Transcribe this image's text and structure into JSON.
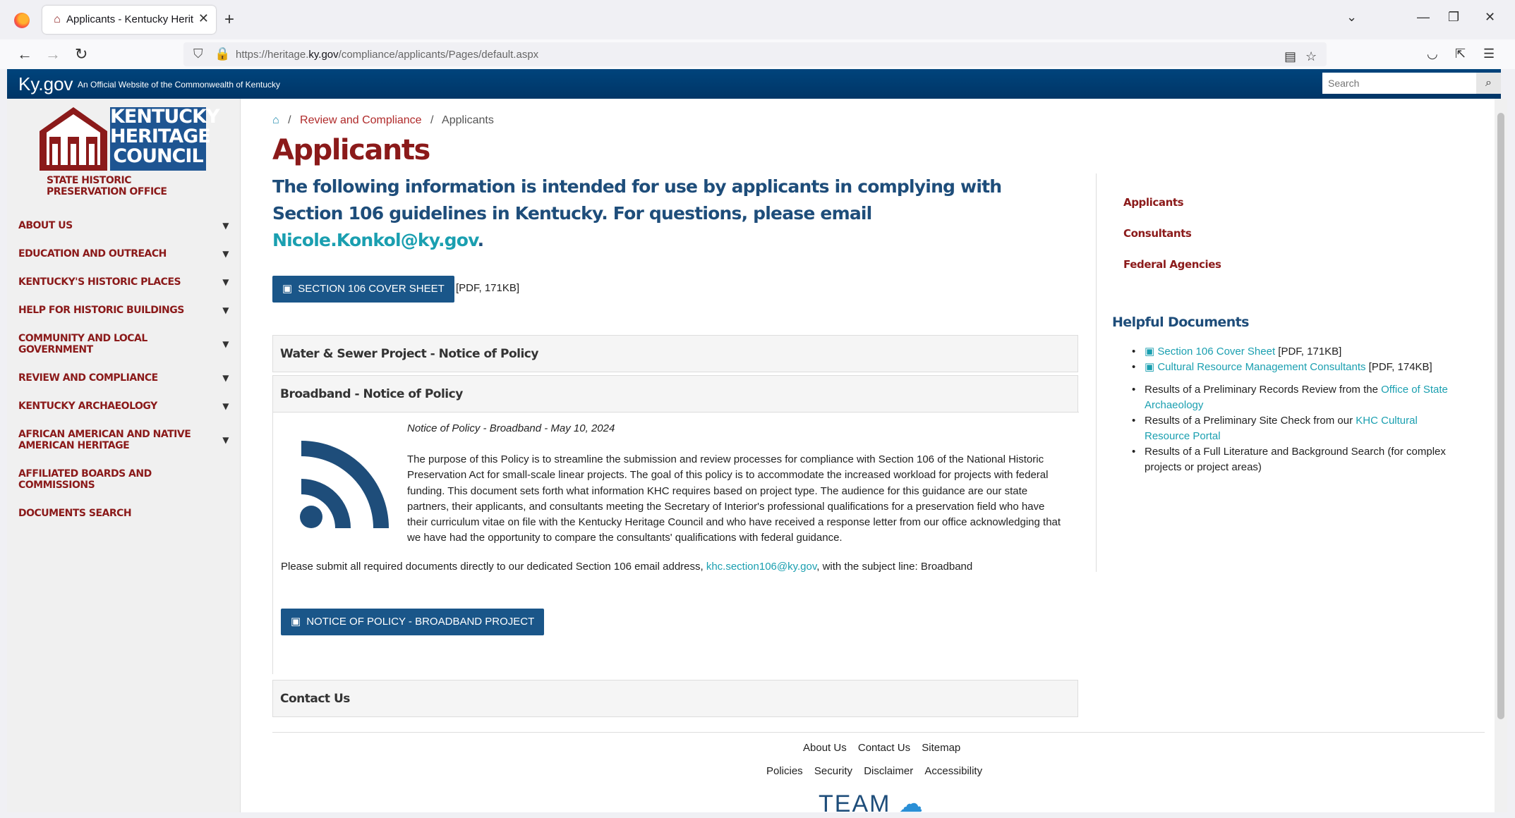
{
  "browser": {
    "tab_title": "Applicants - Kentucky Heritage Council",
    "url_prefix": "https://heritage.",
    "url_domain": "ky.gov",
    "url_path": "/compliance/applicants/Pages/default.aspx"
  },
  "kygov": {
    "logo": "Ky.gov",
    "tagline": "An Official Website of the Commonwealth of Kentucky",
    "search_placeholder": "Search"
  },
  "logo": {
    "line1": "KENTUCKY",
    "line2": "HERITAGE",
    "line3": "COUNCIL",
    "subtitle": "STATE HISTORIC PRESERVATION OFFICE"
  },
  "sidebar": {
    "items": [
      {
        "label": "ABOUT US",
        "caret": true
      },
      {
        "label": "EDUCATION AND OUTREACH",
        "caret": true
      },
      {
        "label": "KENTUCKY'S HISTORIC PLACES",
        "caret": true
      },
      {
        "label": "HELP FOR HISTORIC BUILDINGS",
        "caret": true
      },
      {
        "label": "COMMUNITY AND LOCAL GOVERNMENT",
        "caret": true
      },
      {
        "label": "REVIEW AND COMPLIANCE",
        "caret": true
      },
      {
        "label": "KENTUCKY ARCHAEOLOGY",
        "caret": true
      },
      {
        "label": "AFRICAN AMERICAN AND NATIVE AMERICAN HERITAGE",
        "caret": true
      },
      {
        "label": "AFFILIATED BOARDS AND COMMISSIONS",
        "caret": false
      },
      {
        "label": "DOCUMENTS SEARCH",
        "caret": false
      }
    ]
  },
  "breadcrumb": {
    "sep": "/",
    "parent": "Review and Compliance",
    "current": "Applicants"
  },
  "main": {
    "title": "Applicants",
    "intro": "The following information is intended for use by applicants in complying with Section 106 guidelines in Kentucky. For questions, please email ",
    "intro_email": "Nicole.Konkol@ky.gov",
    "intro_end": ".",
    "cover_button": "SECTION 106 COVER SHEET",
    "cover_meta": "[PDF, 171KB]",
    "accordion": {
      "water": "Water & Sewer Project - Notice of Policy",
      "broadband": "Broadband - Notice of Policy",
      "contact": "Contact Us"
    },
    "notice": {
      "title": "Notice of Policy - Broadband - May 10, 2024",
      "body": "The purpose of this Policy is to streamline the submission and review processes for compliance with Section 106 of the National Historic Preservation Act for small-scale linear projects. The goal of this policy is to accommodate the increased workload for projects with federal funding. This document sets forth what information KHC requires based on project type. The audience for this guidance are our state partners, their applicants, and consultants meeting the Secretary of Interior's professional qualifications for a preservation field who have their curriculum vitae on file with the Kentucky Heritage Council and who have received a response letter from our office acknowledging that we have had the opportunity to compare the consultants' qualifications with federal guidance.",
      "submit_text": "Please submit all required documents directly to our dedicated Section 106 email address, ",
      "submit_email": "khc.section106@ky.gov",
      "submit_end": ", with the subject line: Broadband",
      "button": "NOTICE OF POLICY - BROADBAND PROJECT"
    }
  },
  "right_nav": {
    "items": [
      "Applicants",
      "Consultants",
      "Federal Agencies"
    ],
    "helpful_title": "Helpful Documents",
    "doc1_link": "Section 106 Cover Sheet",
    "doc1_meta": " [PDF, 171KB]",
    "doc2_link": "Cultural Resource Management Consultants",
    "doc2_meta": " [PDF, 174KB]",
    "item3_text": "Results of a Preliminary Records Review from the ",
    "item3_link": "Office of State Archaeology",
    "item4_text": "Results of a Preliminary Site Check from our ",
    "item4_link": "KHC Cultural Resource Portal",
    "item5_text": "Results of a Full Literature and Background Search (for complex projects or project areas)"
  },
  "footer": {
    "row1": [
      "About Us",
      "Contact Us",
      "Sitemap"
    ],
    "row2": [
      "Policies",
      "Security",
      "Disclaimer",
      "Accessibility"
    ],
    "team": "TEAM"
  },
  "colors": {
    "brand_red": "#8b1a1a",
    "brand_blue": "#1e4d7a",
    "link_teal": "#1a9fb0",
    "button_blue": "#1a5689"
  }
}
